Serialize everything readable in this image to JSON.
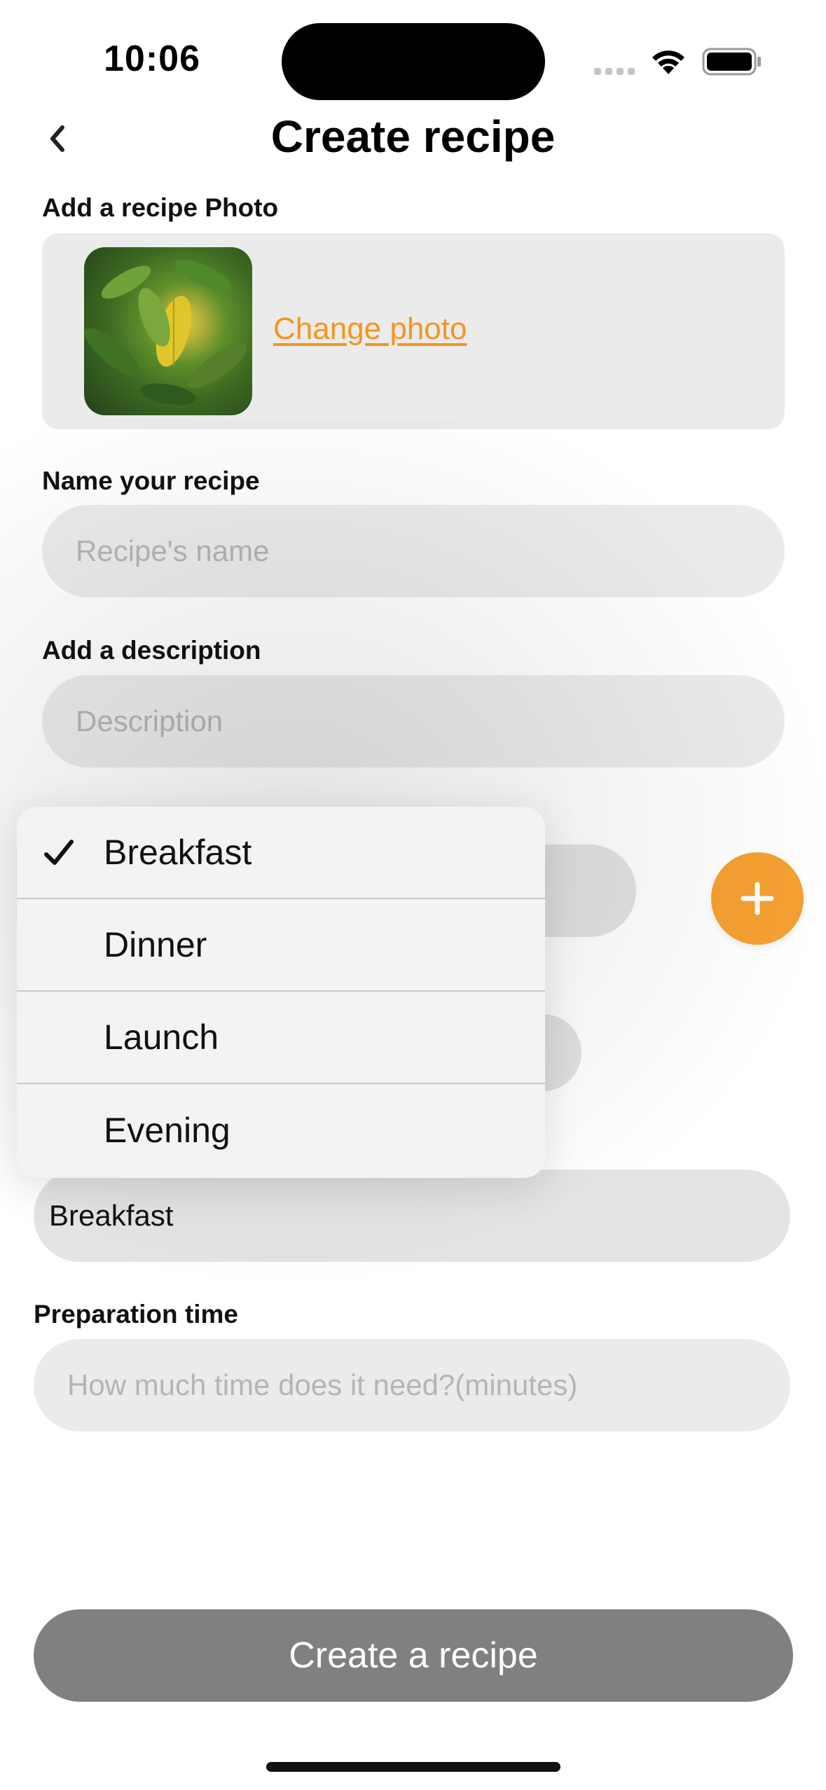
{
  "status_bar": {
    "time": "10:06"
  },
  "header": {
    "title": "Create recipe",
    "back_icon": "chevron-left-icon"
  },
  "photo_section": {
    "label": "Add a recipe Photo",
    "change_link": "Change photo"
  },
  "name_section": {
    "label": "Name your recipe",
    "placeholder": "Recipe's name"
  },
  "description_section": {
    "label": "Add a description",
    "placeholder": "Description"
  },
  "meal_type": {
    "selected_value": "Breakfast",
    "options": [
      {
        "label": "Breakfast",
        "checked": true
      },
      {
        "label": "Dinner",
        "checked": false
      },
      {
        "label": "Launch",
        "checked": false
      },
      {
        "label": "Evening",
        "checked": false
      }
    ]
  },
  "prep_time": {
    "label": "Preparation time",
    "placeholder": "How much time does it need?(minutes)"
  },
  "actions": {
    "create_label": "Create a recipe",
    "add_icon": "plus-icon"
  },
  "colors": {
    "accent": "#f5a032",
    "link": "#f29621",
    "input_bg": "#ebebeb",
    "button_disabled": "#808080"
  }
}
